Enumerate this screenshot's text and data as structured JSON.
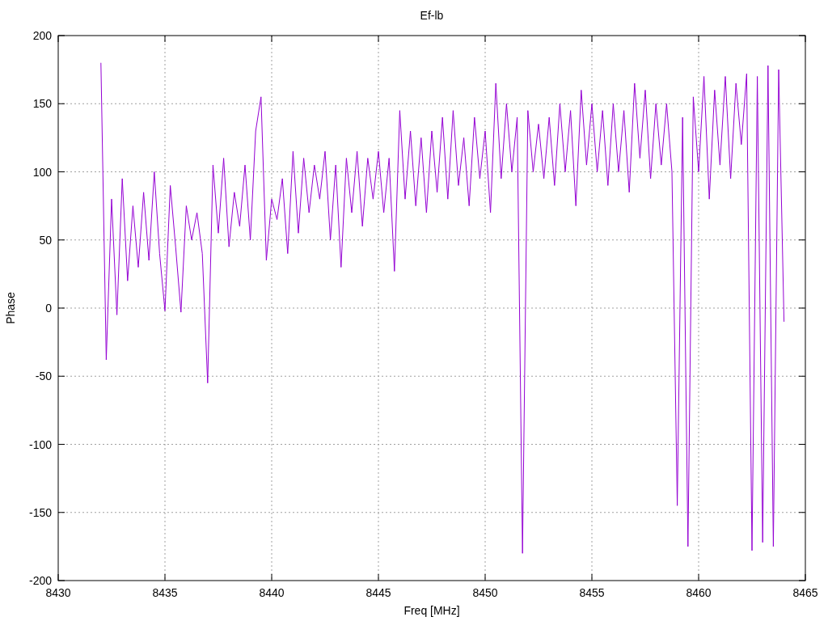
{
  "chart_data": {
    "type": "line",
    "grid": true,
    "title": "Ef-lb",
    "xlabel": "Freq [MHz]",
    "ylabel": "Phase",
    "xlim": [
      8430,
      8465
    ],
    "ylim": [
      -200,
      200
    ],
    "xticks": [
      8430,
      8435,
      8440,
      8445,
      8450,
      8455,
      8460,
      8465
    ],
    "yticks": [
      -200,
      -150,
      -100,
      -50,
      0,
      50,
      100,
      150,
      200
    ],
    "x": [
      8432,
      8432.25,
      8432.5,
      8432.75,
      8433,
      8433.25,
      8433.5,
      8433.75,
      8434,
      8434.25,
      8434.5,
      8434.75,
      8435,
      8435.25,
      8435.5,
      8435.75,
      8436,
      8436.25,
      8436.5,
      8436.75,
      8437,
      8437.25,
      8437.5,
      8437.75,
      8438,
      8438.25,
      8438.5,
      8438.75,
      8439,
      8439.25,
      8439.5,
      8439.75,
      8440,
      8440.25,
      8440.5,
      8440.75,
      8441,
      8441.25,
      8441.5,
      8441.75,
      8442,
      8442.25,
      8442.5,
      8442.75,
      8443,
      8443.25,
      8443.5,
      8443.75,
      8444,
      8444.25,
      8444.5,
      8444.75,
      8445,
      8445.25,
      8445.5,
      8445.75,
      8446,
      8446.25,
      8446.5,
      8446.75,
      8447,
      8447.25,
      8447.5,
      8447.75,
      8448,
      8448.25,
      8448.5,
      8448.75,
      8449,
      8449.25,
      8449.5,
      8449.75,
      8450,
      8450.25,
      8450.5,
      8450.75,
      8451,
      8451.25,
      8451.5,
      8451.75,
      8452,
      8452.25,
      8452.5,
      8452.75,
      8453,
      8453.25,
      8453.5,
      8453.75,
      8454,
      8454.25,
      8454.5,
      8454.75,
      8455,
      8455.25,
      8455.5,
      8455.75,
      8456,
      8456.25,
      8456.5,
      8456.75,
      8457,
      8457.25,
      8457.5,
      8457.75,
      8458,
      8458.25,
      8458.5,
      8458.75,
      8459,
      8459.25,
      8459.5,
      8459.75,
      8460,
      8460.25,
      8460.5,
      8460.75,
      8461,
      8461.25,
      8461.5,
      8461.75,
      8462,
      8462.25,
      8462.5,
      8462.75,
      8463,
      8463.25,
      8463.5,
      8463.75,
      8464
    ],
    "series": [
      {
        "color": "#9400d3",
        "values": [
          180,
          -38,
          80,
          -5,
          95,
          20,
          75,
          30,
          85,
          35,
          100,
          40,
          -2,
          90,
          45,
          -3,
          75,
          50,
          70,
          40,
          -55,
          105,
          55,
          110,
          45,
          85,
          60,
          105,
          50,
          130,
          155,
          35,
          80,
          65,
          95,
          40,
          115,
          55,
          110,
          70,
          105,
          80,
          115,
          50,
          105,
          30,
          110,
          70,
          115,
          60,
          110,
          80,
          115,
          70,
          110,
          27,
          145,
          80,
          130,
          75,
          125,
          70,
          130,
          85,
          140,
          80,
          145,
          90,
          125,
          75,
          140,
          95,
          130,
          70,
          165,
          95,
          150,
          100,
          140,
          -180,
          145,
          100,
          135,
          95,
          140,
          90,
          150,
          100,
          145,
          75,
          160,
          105,
          150,
          100,
          145,
          90,
          150,
          100,
          145,
          85,
          165,
          110,
          160,
          95,
          150,
          105,
          150,
          100,
          -145,
          140,
          -175,
          155,
          100,
          170,
          80,
          160,
          105,
          170,
          95,
          165,
          120,
          172,
          -178,
          170,
          -172,
          178,
          -175,
          175,
          -10
        ]
      }
    ]
  }
}
